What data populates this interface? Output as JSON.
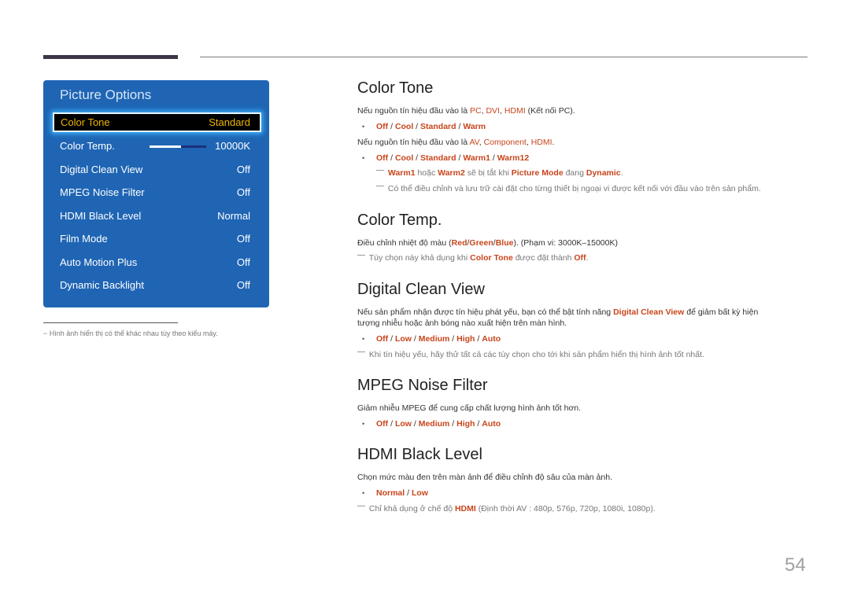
{
  "osd": {
    "title": "Picture Options",
    "items": [
      {
        "label": "Color Tone",
        "value": "Standard",
        "selected": true
      },
      {
        "label": "Color Temp.",
        "value": "10000K",
        "slider_fraction": 0.55
      },
      {
        "label": "Digital Clean View",
        "value": "Off"
      },
      {
        "label": "MPEG Noise Filter",
        "value": "Off"
      },
      {
        "label": "HDMI Black Level",
        "value": "Normal"
      },
      {
        "label": "Film Mode",
        "value": "Off"
      },
      {
        "label": "Auto Motion Plus",
        "value": "Off"
      },
      {
        "label": "Dynamic Backlight",
        "value": "Off"
      }
    ]
  },
  "footnote": "−  Hình ảnh hiển thị có thể khác nhau tùy theo kiểu máy.",
  "sections": {
    "color_tone": {
      "title": "Color Tone",
      "line1_pre": "Nếu nguồn tín hiệu đầu vào là ",
      "line1_hl": [
        "PC",
        "DVI",
        "HDMI"
      ],
      "line1_post": " (Kết nối PC).",
      "options1": [
        "Off",
        "Cool",
        "Standard",
        "Warm"
      ],
      "line2_pre": "Nếu nguồn tín hiệu đầu vào là ",
      "line2_hl": [
        "AV",
        "Component",
        "HDMI"
      ],
      "line2_post": ".",
      "options2": [
        "Off",
        "Cool",
        "Standard",
        "Warm1",
        "Warm12"
      ],
      "note1": {
        "a": "Warm1",
        "b": " hoặc ",
        "c": "Warm2",
        "d": " sẽ bị tắt khi ",
        "e": "Picture Mode",
        "f": " đang ",
        "g": "Dynamic",
        "h": "."
      },
      "note2": "Có thể điều chỉnh và lưu trữ cài đặt cho từng thiết bị ngoại vi được kết nối với đầu vào trên sản phẩm."
    },
    "color_temp": {
      "title": "Color Temp.",
      "desc_pre": "Điều chỉnh nhiệt độ màu (",
      "desc_hl": [
        "Red",
        "Green",
        "Blue"
      ],
      "desc_post": "). (Phạm vi: 3000K–15000K)",
      "note": {
        "a": "Tùy chọn này khả dụng khi ",
        "b": "Color Tone",
        "c": " được đặt thành ",
        "d": "Off",
        "e": "."
      }
    },
    "digital_clean_view": {
      "title": "Digital Clean View",
      "desc_pre": "Nếu sản phẩm nhận được tín hiệu phát yếu, bạn có thể bật tính năng ",
      "desc_hl": "Digital Clean View",
      "desc_post": " để giảm bất kỳ hiện",
      "desc_line2": "tượng nhiễu hoặc ảnh bóng nào xuất hiện trên màn hình.",
      "options": [
        "Off",
        "Low",
        "Medium",
        "High",
        "Auto"
      ],
      "note": "Khi tín hiệu yếu, hãy thử tất cả các tùy chọn cho tới khi sản phẩm hiển thị hình ảnh tốt nhất."
    },
    "mpeg_noise_filter": {
      "title": "MPEG Noise Filter",
      "desc": "Giảm nhiễu MPEG để cung cấp chất lượng hình ảnh tốt hơn.",
      "options": [
        "Off",
        "Low",
        "Medium",
        "High",
        "Auto"
      ]
    },
    "hdmi_black_level": {
      "title": "HDMI Black Level",
      "desc": "Chọn mức màu đen trên màn ảnh để điều chỉnh độ sâu của màn ảnh.",
      "options": [
        "Normal",
        "Low"
      ],
      "note": {
        "a": "Chỉ khả dụng ở chế độ ",
        "b": "HDMI",
        "c": " (Định thời AV : 480p, 576p, 720p, 1080i, 1080p)."
      }
    }
  },
  "page_number": "54",
  "separator": " / ",
  "comma": ", ",
  "bullet": "•"
}
